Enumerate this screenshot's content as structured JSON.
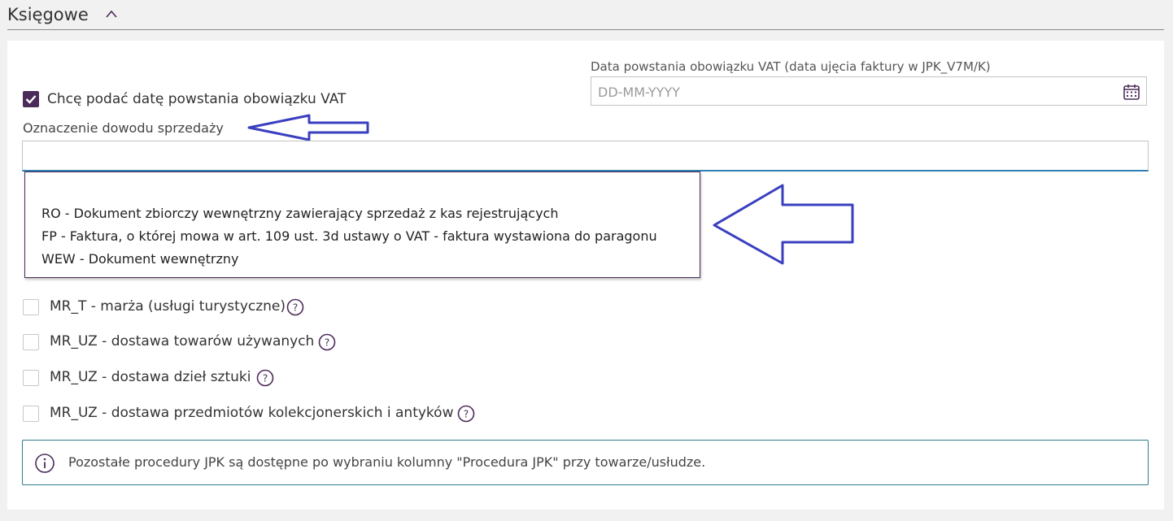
{
  "section": {
    "title": "Księgowe"
  },
  "vat_date": {
    "label": "Data powstania obowiązku VAT (data ujęcia faktury w JPK_V7M/K)",
    "placeholder": "DD-MM-YYYY",
    "value": ""
  },
  "vat_checkbox": {
    "label": "Chcę podać datę powstania obowiązku VAT",
    "checked": true
  },
  "sale_proof": {
    "label": "Oznaczenie dowodu sprzedaży",
    "value": ""
  },
  "dropdown_options": [
    "RO - Dokument zbiorczy wewnętrzny zawierający sprzedaż z kas rejestrujących",
    "FP - Faktura, o której mowa w art. 109 ust. 3d ustawy o VAT - faktura wystawiona do paragonu",
    "WEW - Dokument wewnętrzny"
  ],
  "procedures": [
    {
      "label": "MR_T - marża (usługi turystyczne)",
      "checked": false
    },
    {
      "label": "MR_UZ - dostawa towarów używanych",
      "checked": false
    },
    {
      "label": "MR_UZ - dostawa dzieł sztuki",
      "checked": false
    },
    {
      "label": "MR_UZ - dostawa przedmiotów kolekcjonerskich i antyków",
      "checked": false
    }
  ],
  "info": {
    "text": "Pozostałe procedury JPK są dostępne po wybraniu kolumny \"Procedura JPK\" przy towarze/usłudze."
  },
  "colors": {
    "accent": "#4b2b59",
    "input_focus": "#2f7fb5",
    "info_border": "#2f7d8b",
    "annotation_arrow": "#3a3fbf"
  },
  "icons": [
    "chevron-up-icon",
    "calendar-icon",
    "check-icon",
    "help-icon",
    "info-icon",
    "arrow-left-icon"
  ]
}
